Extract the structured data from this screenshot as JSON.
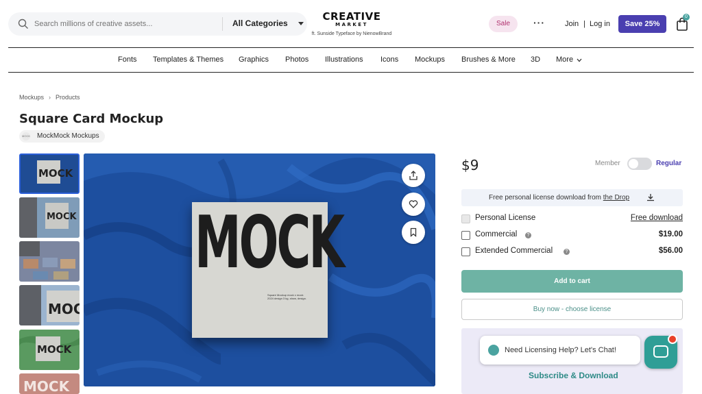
{
  "header": {
    "search_placeholder": "Search millions of creative assets...",
    "category_select": "All Categories",
    "logo_line1": "CREATIVE",
    "logo_line2": "MARKET",
    "logo_tagline": "ft. Sunside Typeface by NienowBrand",
    "sale": "Sale",
    "more_dots": "···",
    "join": "Join",
    "separator": "|",
    "login": "Log in",
    "save_button": "Save 25%",
    "cart_count": "0"
  },
  "nav": {
    "items": [
      "Fonts",
      "Templates & Themes",
      "Graphics",
      "Photos",
      "Illustrations",
      "Icons",
      "Mockups",
      "Brushes & More",
      "3D",
      "More"
    ]
  },
  "breadcrumb": [
    "Mockups",
    "Products"
  ],
  "product": {
    "title": "Square Card Mockup",
    "shop_name": "MockMock Mockups",
    "shop_avatar_text": "MOCK",
    "card_text": "MOCK",
    "card_small_text": "Square Mockup mock x mock 2024 design 3 kg, show, design."
  },
  "purchase": {
    "price": "$9",
    "member_label": "Member",
    "regular_label": "Regular",
    "drop_text": "Free personal license download from",
    "drop_link": "the Drop",
    "licenses": [
      {
        "name": "Personal License",
        "price": "Free download"
      },
      {
        "name": "Commercial",
        "price": "$19.00"
      },
      {
        "name": "Extended Commercial",
        "price": "$56.00"
      }
    ],
    "info_glyph": "?",
    "add_to_cart": "Add to cart",
    "buy_now": "Buy now - choose license",
    "help_text": "Need Licensing Help? Let's Chat!",
    "subscribe": "Subscribe & Download"
  },
  "colors": {
    "brand_purple": "#4a3fb0",
    "teal": "#6eb3a4",
    "fabric_blue": "#1d4f9f"
  }
}
